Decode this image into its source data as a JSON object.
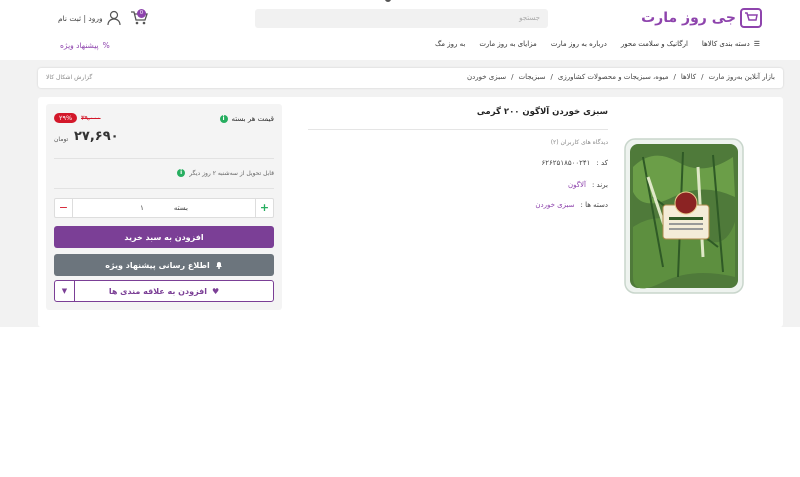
{
  "header": {
    "logo_text": "جی روز مارت",
    "search_placeholder": "جستجو",
    "account_label": "ورود | ثبت نام",
    "cart_count": "0"
  },
  "nav": {
    "items": [
      {
        "label": "دسته بندی کالاها"
      },
      {
        "label": "ارگانیک و سلامت محور"
      },
      {
        "label": "درباره به روز مارت"
      },
      {
        "label": "مزایای به روز مارت"
      },
      {
        "label": "به روز مگ"
      }
    ],
    "special_offer": "پیشنهاد ویژه"
  },
  "breadcrumb": {
    "items": [
      "بازار آنلاین بەروز مارت",
      "کالاها",
      "میوه، سبزیجات و محصولات کشاورزی",
      "سبزیجات",
      "سبزی خوردن"
    ],
    "report": "گزارش اشکال کالا"
  },
  "product": {
    "title": "سبزی خوردن آلاگون ۲۰۰ گرمی",
    "reviews": "دیدگاه های کاربران (۲)",
    "code_label": "کد :",
    "code_value": "۶۲۶۲۵۱۸۵۰۰۲۴۱",
    "brand_label": "برند :",
    "brand_value": "آلاگون",
    "category_label": "دسته ها :",
    "category_value": "سبزی خوردن"
  },
  "buy_box": {
    "price_label": "قیمت هر بسته",
    "discount": "۲۹%",
    "old_price": "۳۹,۰۰۰",
    "new_price": "۲۷,۶۹۰",
    "currency": "تومان",
    "delivery": "قابل تحویل از سه‌شنبه ۲ روز دیگر",
    "qty_value": "۱",
    "qty_unit": "بسته",
    "add_to_cart": "افزودن به سبد خرید",
    "notify": "اطلاع رسانی پیشنهاد ویژه",
    "favorite": "افزودن به علاقه مندی ها"
  },
  "colors": {
    "brand": "#8e44ad",
    "primary_button": "#7b3f96",
    "secondary_button": "#6c757d",
    "discount": "#d3182a",
    "success": "#27ae60"
  }
}
